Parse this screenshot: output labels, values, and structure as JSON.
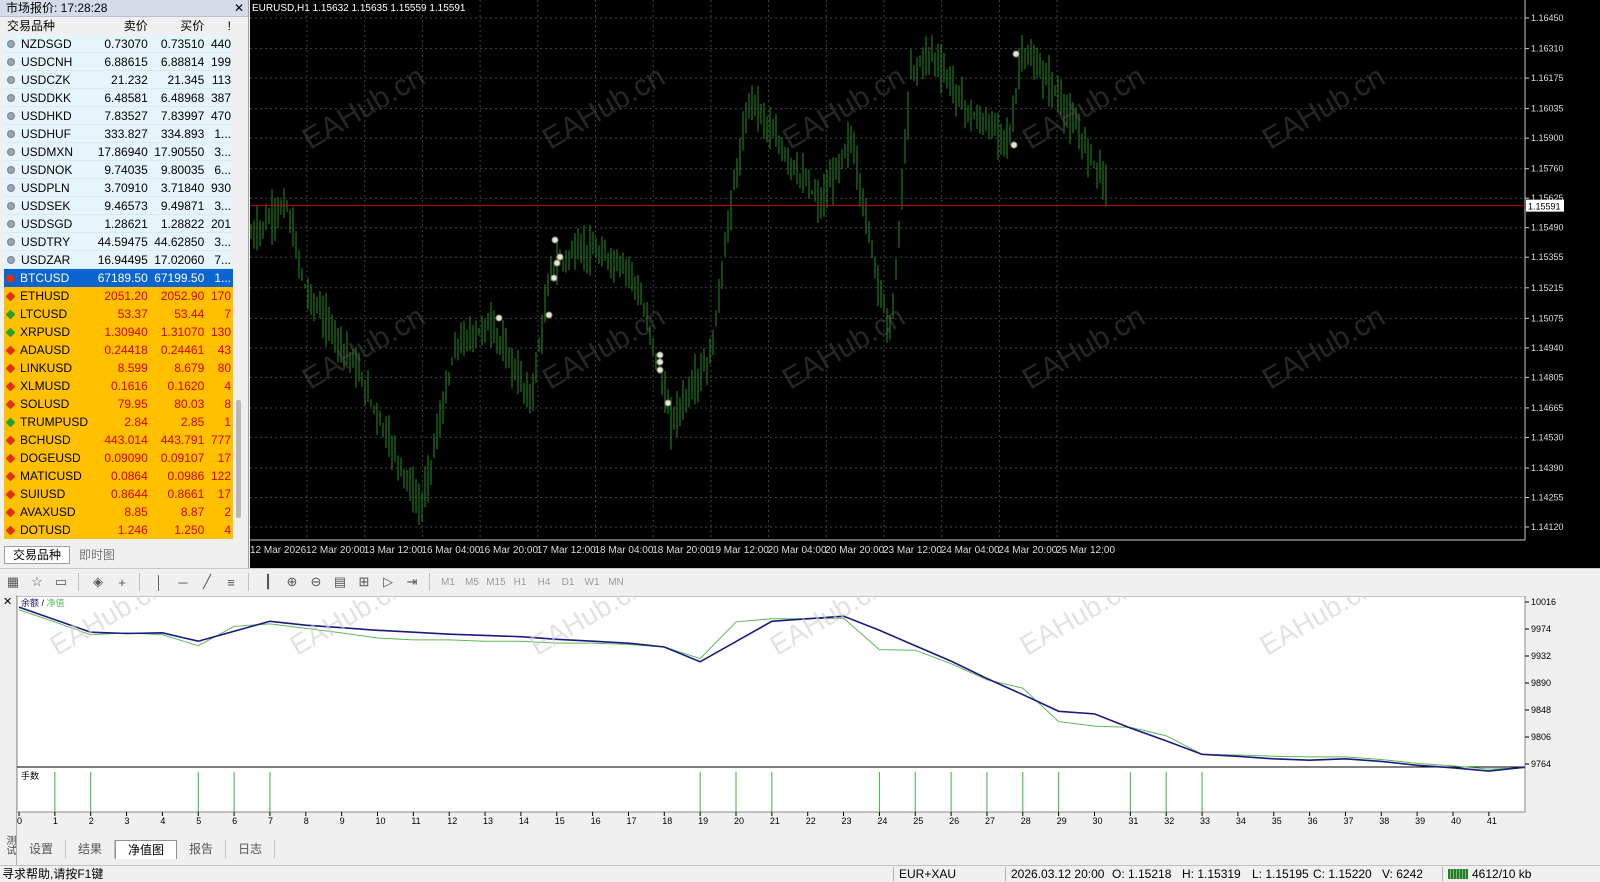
{
  "market_watch": {
    "title": "市场报价: 17:28:28",
    "headers": [
      "交易品种",
      "卖价",
      "买价",
      "!"
    ],
    "rows": [
      {
        "symbol": "NZDSGD",
        "bid": "0.73070",
        "ask": "0.73510",
        "spread": "440",
        "style": "fx",
        "icon": "grey-dot"
      },
      {
        "symbol": "USDCNH",
        "bid": "6.88615",
        "ask": "6.88814",
        "spread": "199",
        "style": "fx",
        "icon": "grey-dot"
      },
      {
        "symbol": "USDCZK",
        "bid": "21.232",
        "ask": "21.345",
        "spread": "113",
        "style": "fx",
        "icon": "grey-dot"
      },
      {
        "symbol": "USDDKK",
        "bid": "6.48581",
        "ask": "6.48968",
        "spread": "387",
        "style": "fx",
        "icon": "grey-dot"
      },
      {
        "symbol": "USDHKD",
        "bid": "7.83527",
        "ask": "7.83997",
        "spread": "470",
        "style": "fx",
        "icon": "grey-dot"
      },
      {
        "symbol": "USDHUF",
        "bid": "333.827",
        "ask": "334.893",
        "spread": "1...",
        "style": "fx",
        "icon": "grey-dot"
      },
      {
        "symbol": "USDMXN",
        "bid": "17.86940",
        "ask": "17.90550",
        "spread": "3...",
        "style": "fx",
        "icon": "grey-dot"
      },
      {
        "symbol": "USDNOK",
        "bid": "9.74035",
        "ask": "9.80035",
        "spread": "6...",
        "style": "fx",
        "icon": "grey-dot"
      },
      {
        "symbol": "USDPLN",
        "bid": "3.70910",
        "ask": "3.71840",
        "spread": "930",
        "style": "fx",
        "icon": "grey-dot"
      },
      {
        "symbol": "USDSEK",
        "bid": "9.46573",
        "ask": "9.49871",
        "spread": "3...",
        "style": "fx",
        "icon": "grey-dot"
      },
      {
        "symbol": "USDSGD",
        "bid": "1.28621",
        "ask": "1.28822",
        "spread": "201",
        "style": "fx",
        "icon": "grey-dot"
      },
      {
        "symbol": "USDTRY",
        "bid": "44.59475",
        "ask": "44.62850",
        "spread": "3...",
        "style": "fx",
        "icon": "grey-dot"
      },
      {
        "symbol": "USDZAR",
        "bid": "16.94495",
        "ask": "17.02060",
        "spread": "7...",
        "style": "fx",
        "icon": "grey-dot"
      },
      {
        "symbol": "BTCUSD",
        "bid": "67189.50",
        "ask": "67199.50",
        "spread": "1...",
        "style": "sel",
        "icon": "red-diamond"
      },
      {
        "symbol": "ETHUSD",
        "bid": "2051.20",
        "ask": "2052.90",
        "spread": "170",
        "style": "cr",
        "icon": "red-diamond"
      },
      {
        "symbol": "LTCUSD",
        "bid": "53.37",
        "ask": "53.44",
        "spread": "7",
        "style": "cr",
        "icon": "green-diamond"
      },
      {
        "symbol": "XRPUSD",
        "bid": "1.30940",
        "ask": "1.31070",
        "spread": "130",
        "style": "cr",
        "icon": "green-diamond"
      },
      {
        "symbol": "ADAUSD",
        "bid": "0.24418",
        "ask": "0.24461",
        "spread": "43",
        "style": "cr",
        "icon": "red-diamond"
      },
      {
        "symbol": "LINKUSD",
        "bid": "8.599",
        "ask": "8.679",
        "spread": "80",
        "style": "cr",
        "icon": "red-diamond"
      },
      {
        "symbol": "XLMUSD",
        "bid": "0.1616",
        "ask": "0.1620",
        "spread": "4",
        "style": "cr",
        "icon": "red-diamond"
      },
      {
        "symbol": "SOLUSD",
        "bid": "79.95",
        "ask": "80.03",
        "spread": "8",
        "style": "cr",
        "icon": "red-diamond"
      },
      {
        "symbol": "TRUMPUSD",
        "bid": "2.84",
        "ask": "2.85",
        "spread": "1",
        "style": "cr",
        "icon": "green-diamond"
      },
      {
        "symbol": "BCHUSD",
        "bid": "443.014",
        "ask": "443.791",
        "spread": "777",
        "style": "cr",
        "icon": "red-diamond"
      },
      {
        "symbol": "DOGEUSD",
        "bid": "0.09090",
        "ask": "0.09107",
        "spread": "17",
        "style": "cr",
        "icon": "red-diamond"
      },
      {
        "symbol": "MATICUSD",
        "bid": "0.0864",
        "ask": "0.0986",
        "spread": "122",
        "style": "cr",
        "icon": "red-diamond"
      },
      {
        "symbol": "SUIUSD",
        "bid": "0.8644",
        "ask": "0.8661",
        "spread": "17",
        "style": "cr",
        "icon": "red-diamond"
      },
      {
        "symbol": "AVAXUSD",
        "bid": "8.85",
        "ask": "8.87",
        "spread": "2",
        "style": "cr",
        "icon": "red-diamond"
      },
      {
        "symbol": "DOTUSD",
        "bid": "1.246",
        "ask": "1.250",
        "spread": "4",
        "style": "cr",
        "icon": "red-diamond"
      }
    ],
    "tabs": [
      "交易品种",
      "即时图"
    ]
  },
  "chart": {
    "header": "EURUSD,H1  1.15632 1.15635 1.15559 1.15591",
    "current_price": "1.15591",
    "price_ticks": [
      "1.16450",
      "1.16310",
      "1.16175",
      "1.16035",
      "1.15900",
      "1.15760",
      "1.15625",
      "1.15490",
      "1.15355",
      "1.15215",
      "1.15075",
      "1.14940",
      "1.14805",
      "1.14665",
      "1.14530",
      "1.14390",
      "1.14255",
      "1.14120"
    ],
    "time_ticks": [
      "12 Mar 2026",
      "12 Mar 20:00",
      "13 Mar 12:00",
      "16 Mar 04:00",
      "16 Mar 20:00",
      "17 Mar 12:00",
      "18 Mar 04:00",
      "18 Mar 20:00",
      "19 Mar 12:00",
      "20 Mar 04:00",
      "20 Mar 20:00",
      "23 Mar 12:00",
      "24 Mar 04:00",
      "24 Mar 20:00",
      "25 Mar 12:00"
    ],
    "watermark": "EAHub.cn",
    "colors": {
      "background": "#000000",
      "candle": "#1f8f1f",
      "grid": "#3a4a3a",
      "price_line": "#c00000",
      "price_label_bg": "#ffffff"
    }
  },
  "toolbar": {
    "icons": [
      "new-chart-icon",
      "profiles-icon",
      "window-icon",
      "eraser-icon",
      "crosshair-icon",
      "line-icon",
      "hline-icon",
      "pencil-icon",
      "channel-icon",
      "period-separator-icon",
      "zoom-in-icon",
      "zoom-out-icon",
      "tile-icon",
      "add-object-icon",
      "autoscroll-icon",
      "chart-shift-icon"
    ],
    "timeframes": [
      "M1",
      "M5",
      "M15",
      "H1",
      "H4",
      "D1",
      "W1",
      "MN"
    ]
  },
  "tester": {
    "legend_balance": "余额",
    "legend_sep": " / ",
    "legend_equity": "净值",
    "volume_label": "手数",
    "side_label": "测试",
    "tabs": [
      "设置",
      "结果",
      "净值图",
      "报告",
      "日志"
    ],
    "active_tab": "净值图"
  },
  "chart_data": {
    "type": "line",
    "x_label": "",
    "y_ticks": [
      10016,
      9974,
      9932,
      9890,
      9848,
      9806,
      9764
    ],
    "ylim": [
      9764,
      10016
    ],
    "x_ticks": [
      0,
      1,
      2,
      3,
      4,
      5,
      6,
      7,
      8,
      9,
      10,
      11,
      12,
      13,
      14,
      15,
      16,
      17,
      18,
      19,
      20,
      21,
      22,
      23,
      24,
      25,
      26,
      27,
      28,
      29,
      30,
      31,
      32,
      33,
      34,
      35,
      36,
      37,
      38,
      39,
      40,
      41
    ],
    "series": [
      {
        "name": "余额",
        "color": "#1a1a80",
        "x": [
          0,
          2,
          3,
          4,
          5,
          7,
          8,
          9,
          10,
          11,
          12,
          13,
          14,
          15,
          16,
          17,
          18,
          19,
          21,
          23,
          24,
          25,
          26,
          27,
          28,
          29,
          30,
          31,
          32,
          33,
          34,
          35,
          36,
          37,
          38,
          39,
          40,
          41,
          42
        ],
        "values": [
          10008,
          9969,
          9967,
          9968,
          9955,
          9986,
          9980,
          9976,
          9972,
          9969,
          9966,
          9964,
          9962,
          9958,
          9955,
          9952,
          9946,
          9923,
          9986,
          9994,
          9972,
          9948,
          9924,
          9897,
          9872,
          9846,
          9842,
          9820,
          9800,
          9779,
          9776,
          9772,
          9770,
          9772,
          9768,
          9762,
          9758,
          9753,
          9759
        ]
      },
      {
        "name": "净值",
        "color": "#5cb85c",
        "x": [
          0,
          1,
          2,
          3,
          4,
          5,
          6,
          7,
          8,
          9,
          10,
          11,
          12,
          13,
          14,
          15,
          16,
          17,
          18,
          19,
          20,
          21,
          22,
          23,
          24,
          25,
          26,
          27,
          28,
          29,
          30,
          31,
          32,
          33,
          34,
          35,
          36,
          37,
          38,
          39,
          40,
          41,
          42
        ],
        "values": [
          10004,
          9985,
          9965,
          9968,
          9965,
          9948,
          9978,
          9982,
          9975,
          9968,
          9960,
          9957,
          9957,
          9955,
          9955,
          9952,
          9952,
          9950,
          9946,
          9928,
          9985,
          9990,
          9990,
          9991,
          9942,
          9941,
          9920,
          9895,
          9882,
          9830,
          9823,
          9821,
          9808,
          9779,
          9778,
          9776,
          9775,
          9775,
          9771,
          9765,
          9761,
          9756,
          9758
        ]
      }
    ],
    "volume_bars_x": [
      1,
      2,
      5,
      6,
      7,
      19,
      20,
      21,
      24,
      25,
      26,
      27,
      28,
      29,
      31,
      32,
      33
    ]
  },
  "status": {
    "help": "寻求帮助,请按F1键",
    "symbol": "EUR+XAU",
    "time": "2026.03.12 20:00",
    "open": "O: 1.15218",
    "high": "H: 1.15319",
    "low": "L: 1.15195",
    "close": "C: 1.15220",
    "volume": "V: 6242",
    "traffic": "4612/10 kb"
  }
}
